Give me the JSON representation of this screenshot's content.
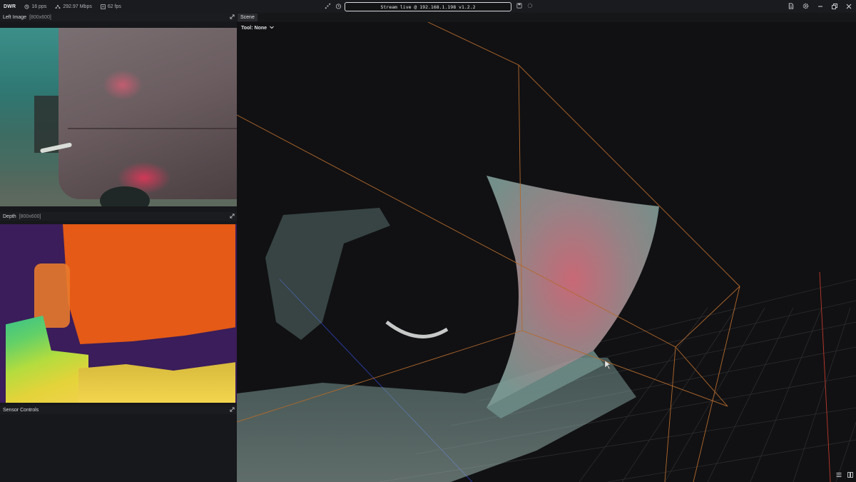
{
  "topbar": {
    "brand": "DWR",
    "pps": "16 pps",
    "bandwidth": "292.97 Mbps",
    "fps": "62 fps",
    "stream": "Stream live @ 192.168.1.198 v1.2.2",
    "icons": [
      "dots-icon",
      "stopwatch-icon",
      "refresh-icon",
      "file-icon",
      "settings-icon",
      "minimize-icon",
      "restore-icon",
      "close-icon"
    ]
  },
  "left_image": {
    "title": "Left Image",
    "resolution": "[800x600]"
  },
  "depth": {
    "title": "Depth",
    "resolution": "[800x600]"
  },
  "sensor_controls": {
    "title": "Sensor Controls"
  },
  "scene": {
    "tab": "Scene",
    "tool_label": "Tool: None",
    "bbox_color": "#b4692c",
    "grid_color": "#2c2d30",
    "axis_x_color": "#c0392b",
    "axis_y_color": "#2c3fb0"
  },
  "colors": {
    "accent": "#e45a16",
    "background": "#111214",
    "panel": "#17181b"
  }
}
